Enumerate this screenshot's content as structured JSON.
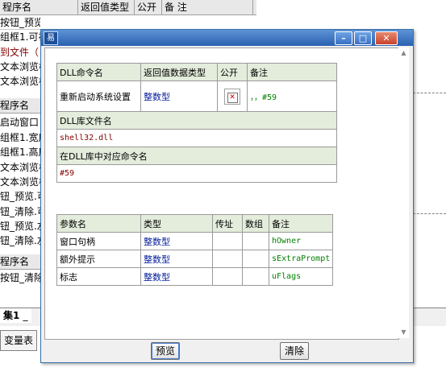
{
  "background": {
    "header": {
      "col_name": "程序名",
      "col_return": "返回值类型",
      "col_public": "公开",
      "col_note": "备 注"
    },
    "rows": [
      "按钮_预览_被单击",
      "组框1.可视",
      "到文件（",
      "文本浏览框",
      "文本浏览框",
      "程序名",
      "启动窗口",
      "组框1.宽度",
      "组框1.高度",
      "文本浏览框",
      "文本浏览框",
      "钮_预览.可",
      "钮_清除.可",
      "钮_预览.左",
      "钮_清除.左",
      "程序名",
      "按钮_清除"
    ],
    "tab_active": "集1",
    "tab_next": "_",
    "var_table_label": "变量表"
  },
  "dialog": {
    "icon": "易",
    "titlebar_buttons": [
      "minimize-icon",
      "maximize-icon",
      "close-icon"
    ],
    "dll": {
      "h_name": "DLL命令名",
      "h_return": "返回值数据类型",
      "h_public": "公开",
      "h_note": "备注",
      "name": "重新启动系统设置",
      "return_type": "整数型",
      "note": "，，#59",
      "lib_header": "DLL库文件名",
      "lib_value": "shell32.dll",
      "cmd_header": "在DLL库中对应命令名",
      "cmd_value": "#59",
      "params_header": {
        "name": "参数名",
        "type": "类型",
        "byref": "传址",
        "array": "数组",
        "note": "备注"
      },
      "params": [
        {
          "name": "窗口句柄",
          "type": "整数型",
          "note": "hOwner"
        },
        {
          "name": "额外提示",
          "type": "整数型",
          "note": "sExtraPrompt"
        },
        {
          "name": "标志",
          "type": "整数型",
          "note": "uFlags"
        }
      ]
    },
    "buttons": {
      "preview": "预览",
      "clear": "清除"
    }
  }
}
